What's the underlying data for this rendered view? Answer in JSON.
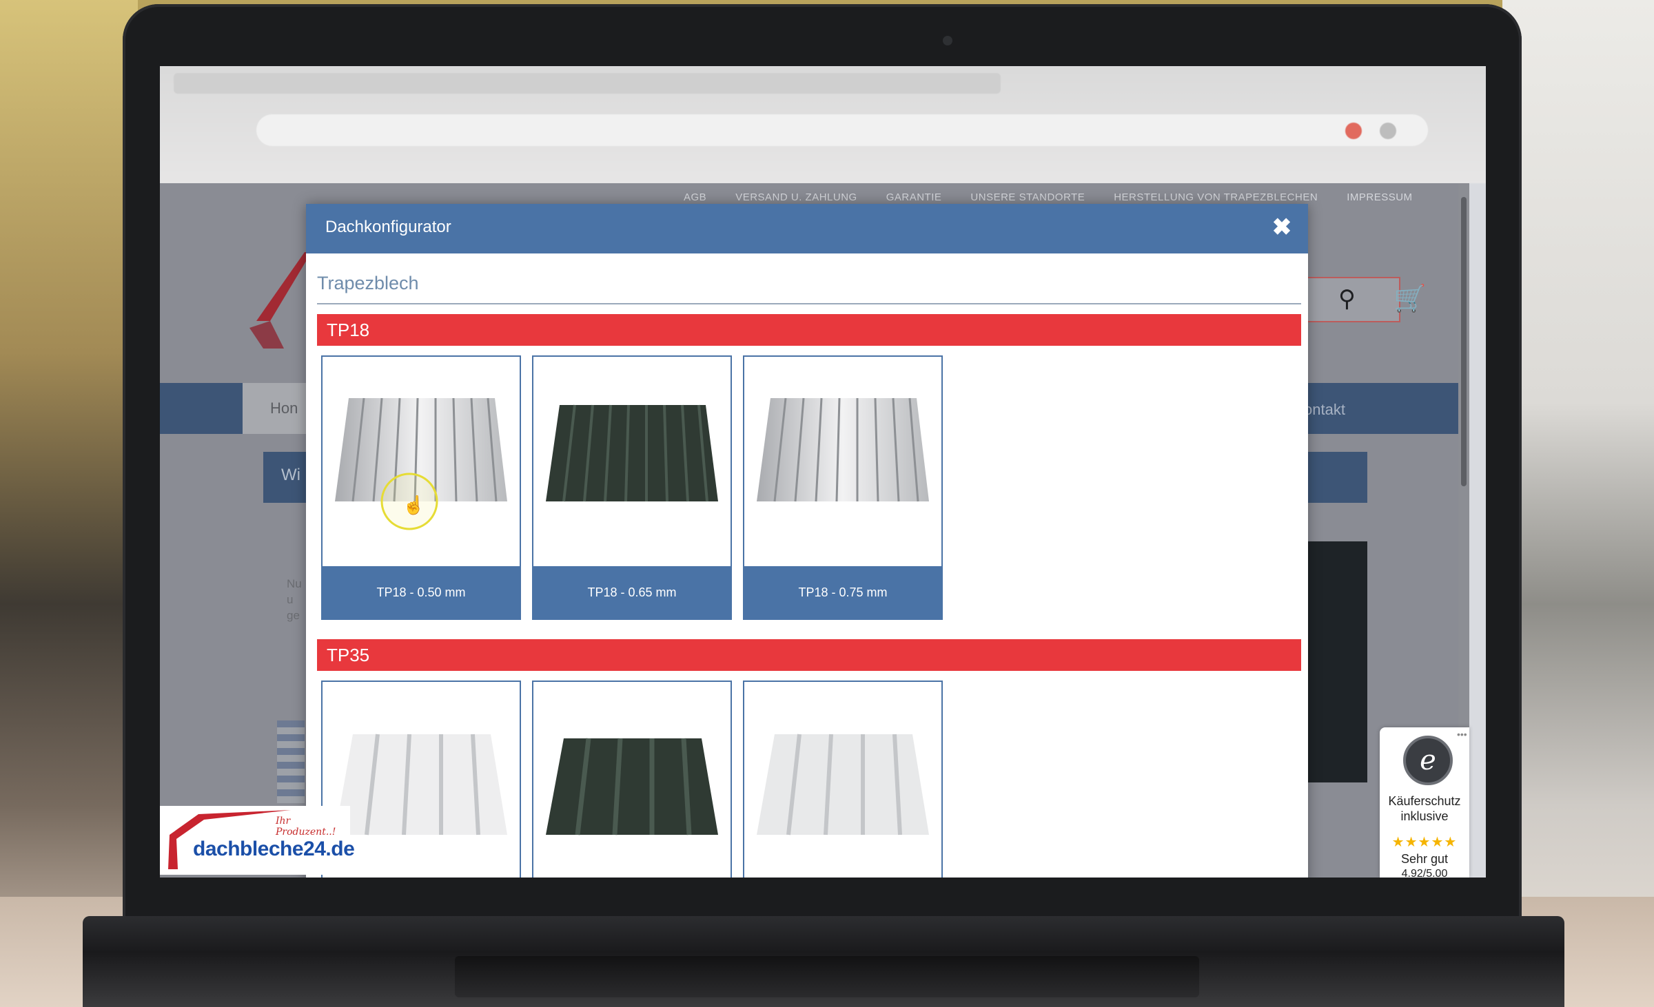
{
  "site": {
    "top_links": [
      "AGB",
      "VERSAND U. ZAHLUNG",
      "GARANTIE",
      "UNSERE STANDORTE",
      "HERSTELLUNG VON TRAPEZBLECHEN",
      "IMPRESSUM"
    ],
    "nav_home": "Hon",
    "nav_contact": "ontakt",
    "side_heading": "Wi",
    "side_text_lines": [
      "Nu",
      "u",
      "ge"
    ]
  },
  "modal": {
    "title": "Dachkonfigurator",
    "close_symbol": "✖",
    "category": "Trapezblech",
    "groups": [
      {
        "label": "TP18",
        "products": [
          {
            "label": "TP18 - 0.50 mm",
            "color": "silver"
          },
          {
            "label": "TP18 - 0.65 mm",
            "color": "dark-green"
          },
          {
            "label": "TP18 - 0.75 mm",
            "color": "silver"
          }
        ]
      },
      {
        "label": "TP35",
        "products": [
          {
            "label": "",
            "color": "white"
          },
          {
            "label": "",
            "color": "dark-green"
          },
          {
            "label": "",
            "color": "white"
          }
        ]
      }
    ]
  },
  "trusted_shops": {
    "seal_letter": "e",
    "line1": "Käuferschutz",
    "line2": "inklusive",
    "stars": "★★★★★",
    "rating_text": "Sehr gut",
    "score": "4.92/5.00"
  },
  "watermark": {
    "brand": "dachbleche24.de",
    "tagline": "Ihr Produzent..!"
  },
  "colors": {
    "modal_header": "#4a73a6",
    "group_bar": "#e8383d",
    "sheet_green": "#2f3a33",
    "sheet_silver": "#d6d7d9"
  }
}
